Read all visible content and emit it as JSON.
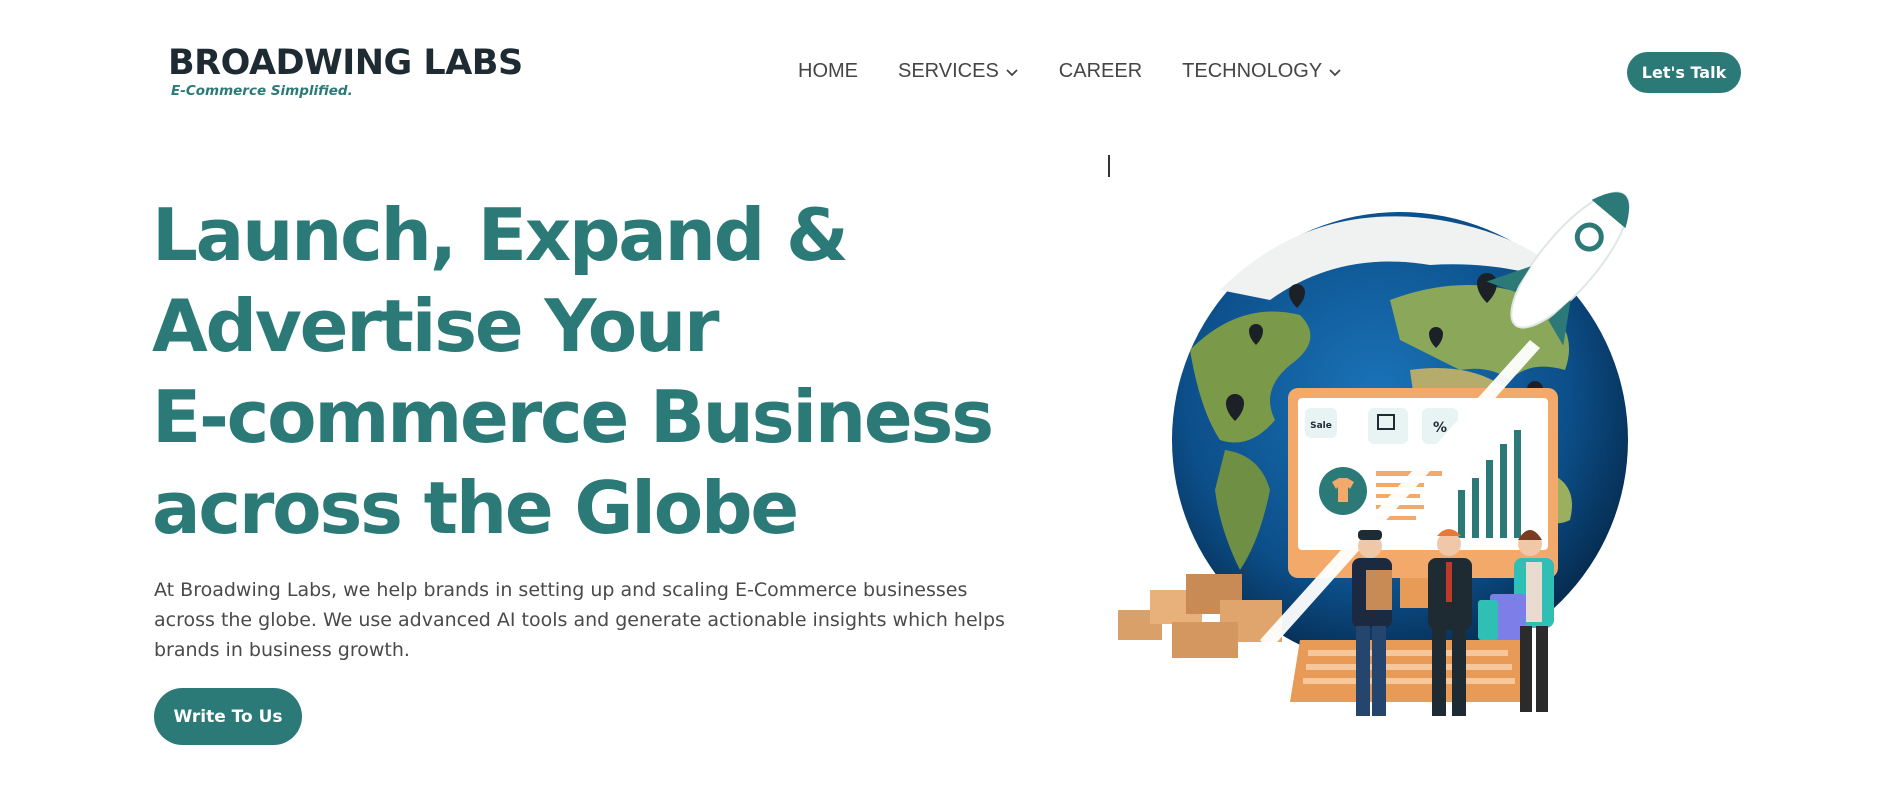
{
  "header": {
    "logo_main": "BROADWING LABS",
    "logo_tagline": "E-Commerce Simplified.",
    "nav": [
      {
        "label": "HOME",
        "has_dropdown": false
      },
      {
        "label": "SERVICES",
        "has_dropdown": true
      },
      {
        "label": "CAREER",
        "has_dropdown": false
      },
      {
        "label": "TECHNOLOGY",
        "has_dropdown": true
      }
    ],
    "cta_label": "Let's Talk"
  },
  "hero": {
    "title_lines": [
      "Launch, Expand &",
      "Advertise Your",
      "E-commerce Business",
      "across the Globe"
    ],
    "description": "At Broadwing Labs, we help brands in setting up and scaling E-Commerce businesses across the globe. We use advanced AI tools and generate actionable insights which helps brands in business growth.",
    "cta_label": "Write To Us"
  },
  "illustration": {
    "screen_badge_sale": "Sale",
    "screen_badge_percent": "%"
  },
  "colors": {
    "brand": "#2b7a78",
    "text_dark": "#1f2b33",
    "text_body": "#4a4a4a"
  }
}
